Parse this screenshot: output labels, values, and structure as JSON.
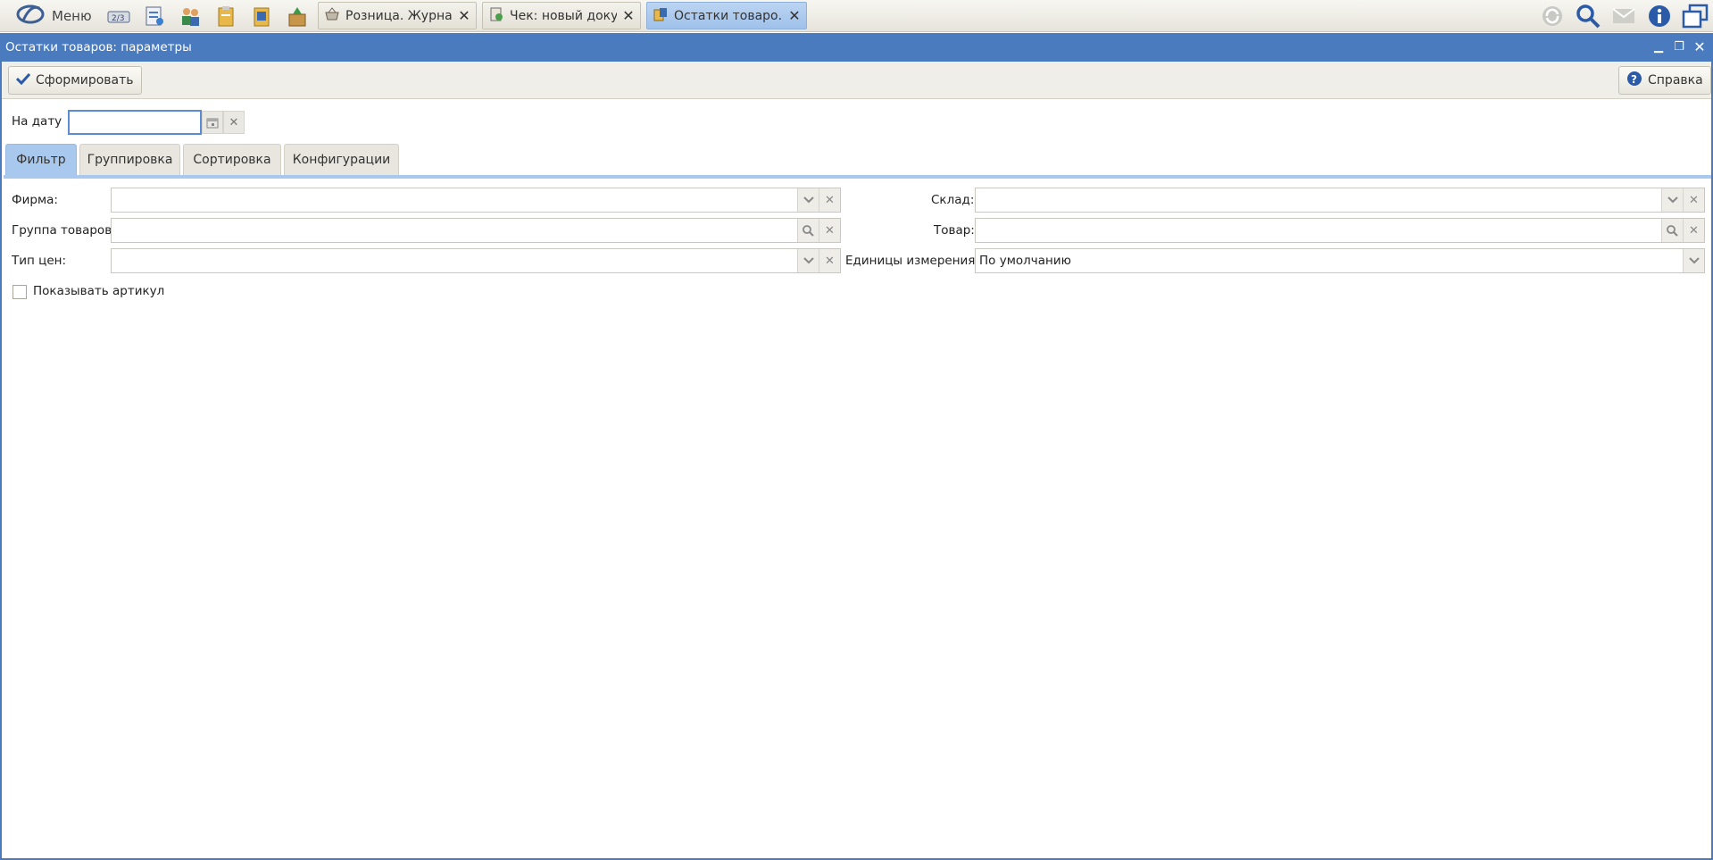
{
  "topbar": {
    "menu_label": "Меню",
    "tabs": [
      {
        "label": "Розница. Журнал",
        "icon": "basket-icon"
      },
      {
        "label": "Чек: новый доку...",
        "icon": "receipt-icon"
      },
      {
        "label": "Остатки товаро...",
        "icon": "goods-icon"
      }
    ],
    "close_glyph": "✕"
  },
  "window": {
    "title": "Остатки товаров: параметры",
    "accent_color": "#4a7bbf"
  },
  "toolbar": {
    "generate_label": "Сформировать",
    "help_label": "Справка"
  },
  "date": {
    "label": "На дату",
    "value": ""
  },
  "param_tabs": [
    "Фильтр",
    "Группировка",
    "Сортировка",
    "Конфигурации"
  ],
  "filter": {
    "firm_label": "Фирма:",
    "firm_value": "",
    "group_label": "Группа товаров:",
    "group_value": "",
    "price_type_label": "Тип цен:",
    "price_type_value": "",
    "warehouse_label": "Склад:",
    "warehouse_value": "",
    "product_label": "Товар:",
    "product_value": "",
    "units_label": "Единицы измерения:",
    "units_value": "По умолчанию",
    "show_article_label": "Показывать артикул",
    "show_article_checked": false
  }
}
